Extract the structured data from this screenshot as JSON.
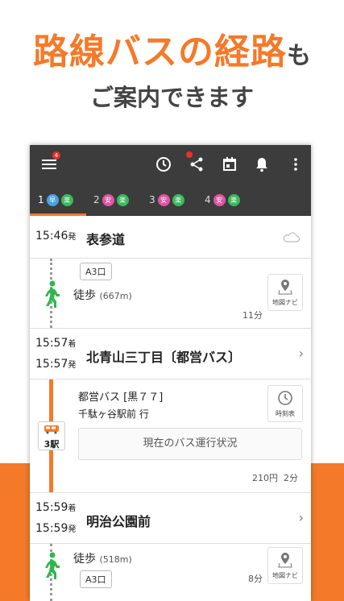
{
  "headline": {
    "orange": "路線バスの経路",
    "tail": "も",
    "sub": "ご案内できます"
  },
  "toolbar": {
    "menu_badge": "4"
  },
  "tabs": [
    {
      "num": "1",
      "b1": "早",
      "b1_color": "#4aa3df",
      "b2": "楽",
      "b2_color": "#3cb95c"
    },
    {
      "num": "2",
      "b1": "安",
      "b1_color": "#e055a4",
      "b2": "楽",
      "b2_color": "#3cb95c"
    },
    {
      "num": "3",
      "b1": "安",
      "b1_color": "#e055a4",
      "b2": "楽",
      "b2_color": "#3cb95c"
    },
    {
      "num": "4",
      "b1": "安",
      "b1_color": "#e055a4",
      "b2": "楽",
      "b2_color": "#3cb95c"
    }
  ],
  "route": {
    "start": {
      "time": "15:46",
      "suffix": "発",
      "name": "表参道"
    },
    "walk1": {
      "exit": "A3口",
      "label": "徒歩",
      "distance": "(667m)",
      "duration": "11分",
      "map_label": "地図ナビ"
    },
    "stop1": {
      "arr_time": "15:57",
      "arr_suffix": "着",
      "dep_time": "15:57",
      "dep_suffix": "発",
      "name": "北青山三丁目〔都営バス〕"
    },
    "bus": {
      "line": "都営バス [黒７７]",
      "direction": "千駄ヶ谷駅前 行",
      "stops": "3駅",
      "timetable_label": "時刻表",
      "status_button": "現在のバス運行状況",
      "fare": "210円",
      "duration": "2分"
    },
    "stop2": {
      "arr_time": "15:59",
      "arr_suffix": "着",
      "dep_time": "15:59",
      "dep_suffix": "発",
      "name": "明治公園前"
    },
    "walk2": {
      "label": "徒歩",
      "distance": "(518m)",
      "exit": "A3口",
      "duration": "8分",
      "map_label": "地図ナビ"
    }
  }
}
